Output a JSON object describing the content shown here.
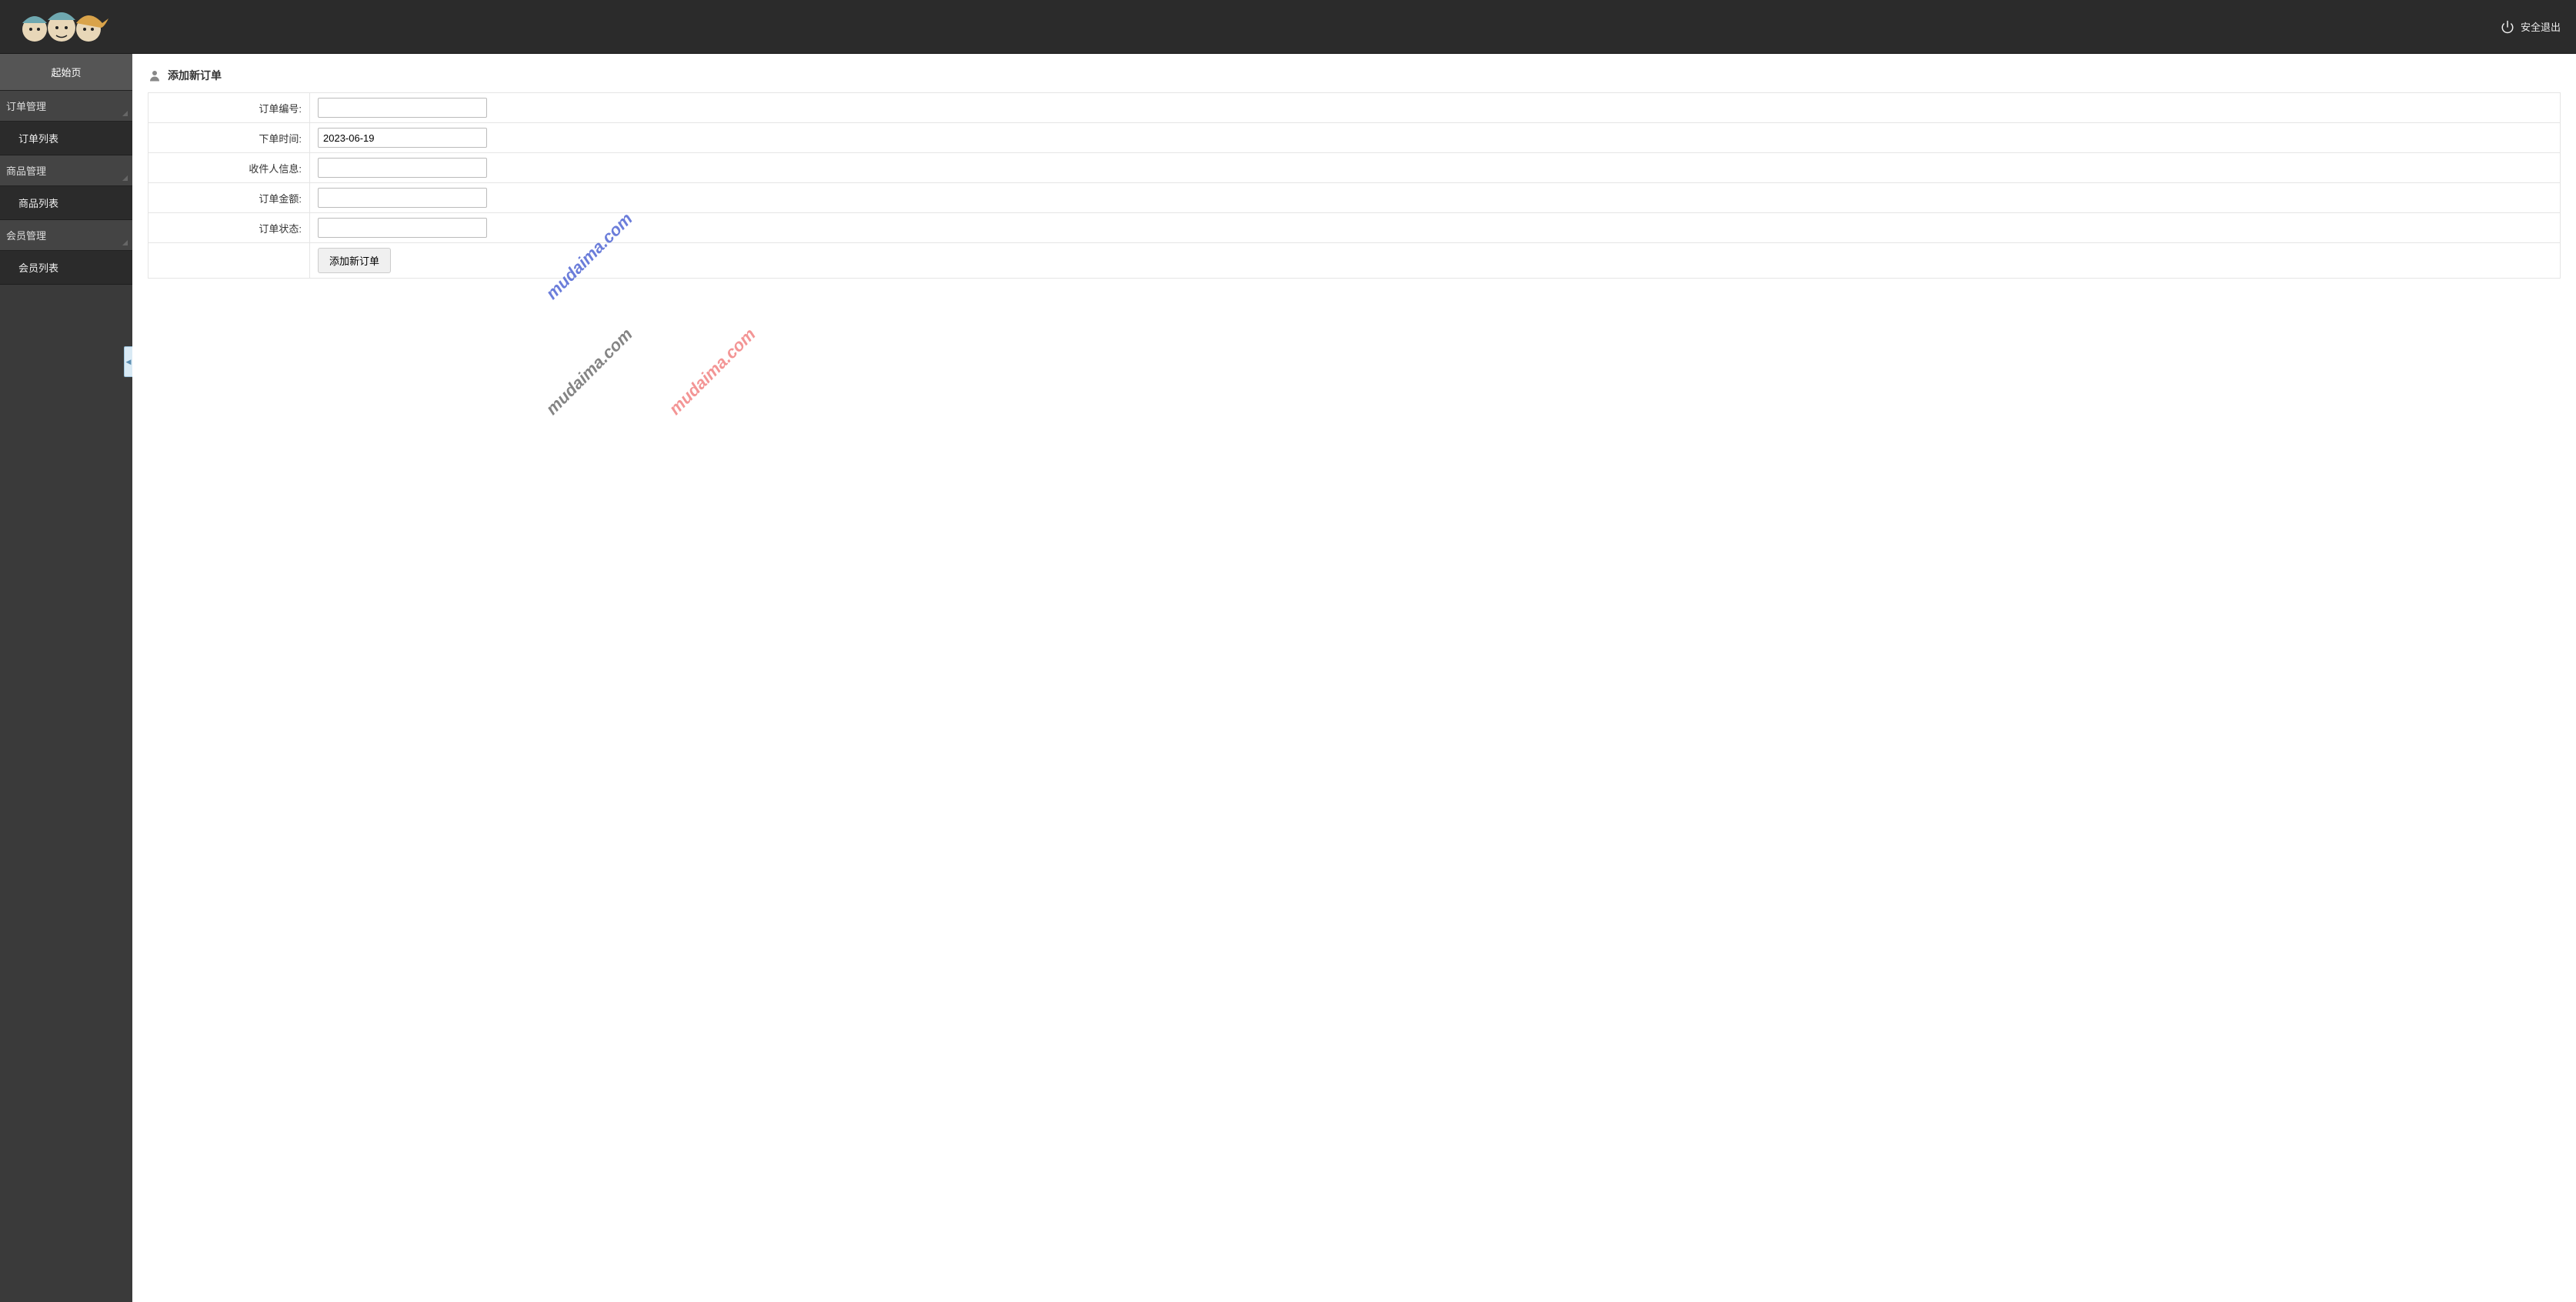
{
  "header": {
    "logout_label": "安全退出"
  },
  "sidebar": {
    "start_page": "起始页",
    "groups": [
      {
        "header": "订单管理",
        "item": "订单列表"
      },
      {
        "header": "商品管理",
        "item": "商品列表"
      },
      {
        "header": "会员管理",
        "item": "会员列表"
      }
    ]
  },
  "page": {
    "title": "添加新订单"
  },
  "form": {
    "fields": [
      {
        "label": "订单编号:",
        "value": ""
      },
      {
        "label": "下单时间:",
        "value": "2023-06-19"
      },
      {
        "label": "收件人信息:",
        "value": ""
      },
      {
        "label": "订单金额:",
        "value": ""
      },
      {
        "label": "订单状态:",
        "value": ""
      }
    ],
    "submit_label": "添加新订单"
  },
  "watermark": "mudaima.com"
}
